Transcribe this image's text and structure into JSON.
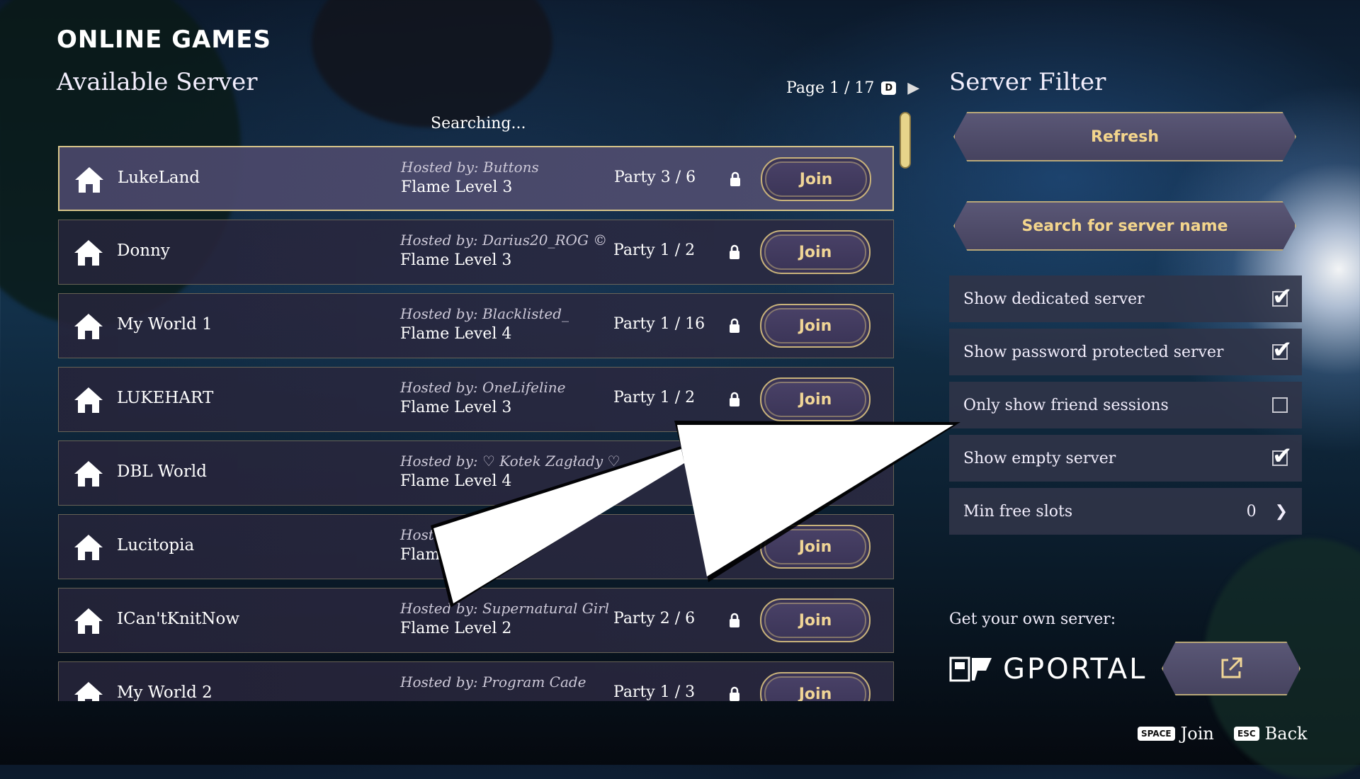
{
  "header": {
    "title": "ONLINE GAMES",
    "subtitle": "Available Server",
    "page_label": "Page 1 / 17",
    "page_key": "D",
    "status": "Searching..."
  },
  "servers": [
    {
      "name": "LukeLand",
      "host": "Hosted by: Buttons",
      "flame": "Flame Level 3",
      "party": "Party 3 / 6",
      "join": "Join"
    },
    {
      "name": "Donny",
      "host": "Hosted by: Darius20_ROG ©",
      "flame": "Flame Level 3",
      "party": "Party 1 / 2",
      "join": "Join"
    },
    {
      "name": "My World 1",
      "host": "Hosted by: Blacklisted_",
      "flame": "Flame Level 4",
      "party": "Party 1 / 16",
      "join": "Join"
    },
    {
      "name": "LUKEHART",
      "host": "Hosted by: OneLifeline",
      "flame": "Flame Level 3",
      "party": "Party 1 / 2",
      "join": "Join"
    },
    {
      "name": "DBL World",
      "host": "Hosted by: ♡ Kotek Zagłady ♡",
      "flame": "Flame Level 4",
      "party": "",
      "join": ""
    },
    {
      "name": "Lucitopia",
      "host": "Host",
      "flame": "Flam",
      "party": "",
      "join": "Join"
    },
    {
      "name": "ICan'tKnitNow",
      "host": "Hosted by: Supernatural Girl",
      "flame": "Flame Level 2",
      "party": "Party 2 / 6",
      "join": "Join"
    },
    {
      "name": "My World 2",
      "host": "Hosted by: Program Cade",
      "flame": "",
      "party": "Party 1 / 3",
      "join": "Join"
    }
  ],
  "filter": {
    "title": "Server Filter",
    "refresh": "Refresh",
    "search": "Search for server name",
    "options": [
      {
        "label": "Show dedicated server",
        "checked": true
      },
      {
        "label": "Show password protected server",
        "checked": true
      },
      {
        "label": "Only show friend sessions",
        "checked": false
      },
      {
        "label": "Show empty server",
        "checked": true
      }
    ],
    "min_slots_label": "Min free slots",
    "min_slots_value": "0"
  },
  "promo": {
    "label": "Get your own server:",
    "brand": "GPORTAL"
  },
  "footer": {
    "join_key": "SPACE",
    "join_label": "Join",
    "back_key": "ESC",
    "back_label": "Back"
  },
  "colors": {
    "accent_gold": "#f0d596",
    "row_bg": "#2c2a42",
    "selected_border": "#d8c58a"
  }
}
